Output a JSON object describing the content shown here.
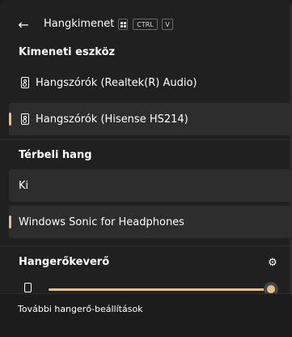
{
  "header": {
    "back_label": "←",
    "title": "Hangkimenet",
    "shortcut": {
      "win_icon": "windows-logo-icon",
      "ctrl": "CTRL",
      "key": "V"
    }
  },
  "output_devices": {
    "title": "Kimeneti eszköz",
    "items": [
      {
        "label": "Hangszórók (Realtek(R) Audio)",
        "icon": "speaker-icon",
        "selected": false
      },
      {
        "label": "Hangszórók (Hisense HS214)",
        "icon": "speaker-icon",
        "selected": true
      }
    ]
  },
  "spatial_sound": {
    "title": "Térbeli hang",
    "items": [
      {
        "label": "Ki",
        "selected": false
      },
      {
        "label": "Windows Sonic for Headphones",
        "selected": true
      }
    ]
  },
  "mixer": {
    "title": "Hangerőkeverő",
    "settings_icon": "gear-icon",
    "app_icon": "speaker-icon",
    "volume_fraction": 1.0
  },
  "footer": {
    "more_link": "További hangerő-beállítások"
  },
  "colors": {
    "accent": "#e3c08b",
    "background": "#202020",
    "row_background": "#2d2d2d"
  }
}
